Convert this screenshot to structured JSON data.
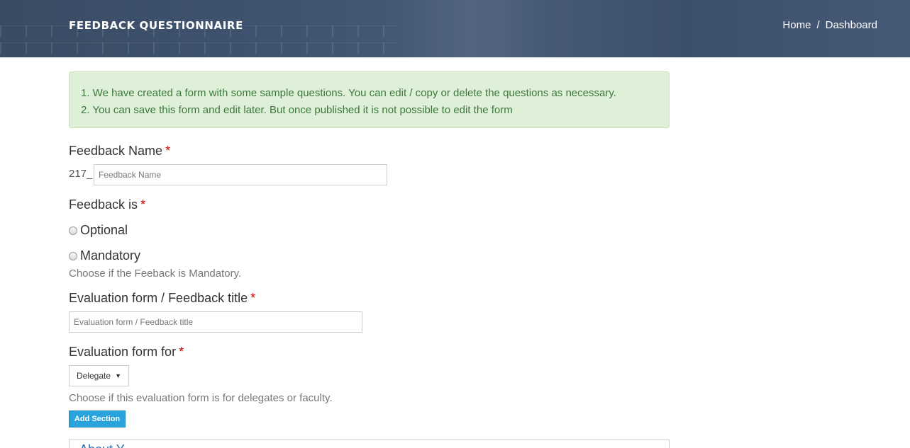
{
  "header": {
    "title": "FEEDBACK QUESTIONNAIRE",
    "breadcrumb": [
      "Home",
      "/",
      "Dashboard"
    ]
  },
  "alert": {
    "lines": [
      "1. We have created a form with some sample questions. You can edit / copy or delete the questions as necessary.",
      "2. You can save this form and edit later. But once published it is not possible to edit the form"
    ]
  },
  "form": {
    "feedback_name": {
      "label": "Feedback Name",
      "required_mark": "*",
      "prefix": "217_",
      "placeholder": "Feedback Name",
      "value": ""
    },
    "feedback_is": {
      "label": "Feedback is",
      "required_mark": "*",
      "options": [
        "Optional",
        "Mandatory"
      ],
      "selected": null,
      "help": "Choose if the Feeback is Mandatory."
    },
    "title": {
      "label": "Evaluation form / Feedback title",
      "required_mark": "*",
      "placeholder": "Evaluation form / Feedback title",
      "value": ""
    },
    "form_for": {
      "label": "Evaluation form for",
      "required_mark": "*",
      "selected": "Delegate",
      "help": "Choose if this evaluation form is for delegates or faculty."
    },
    "add_section_label": "Add Section",
    "section_title": "About Y..."
  },
  "colors": {
    "header_bg": "#3f5370",
    "alert_bg": "#dff0d8",
    "alert_text": "#3c763d",
    "required": "#cc0000",
    "button": "#29a3dc"
  }
}
